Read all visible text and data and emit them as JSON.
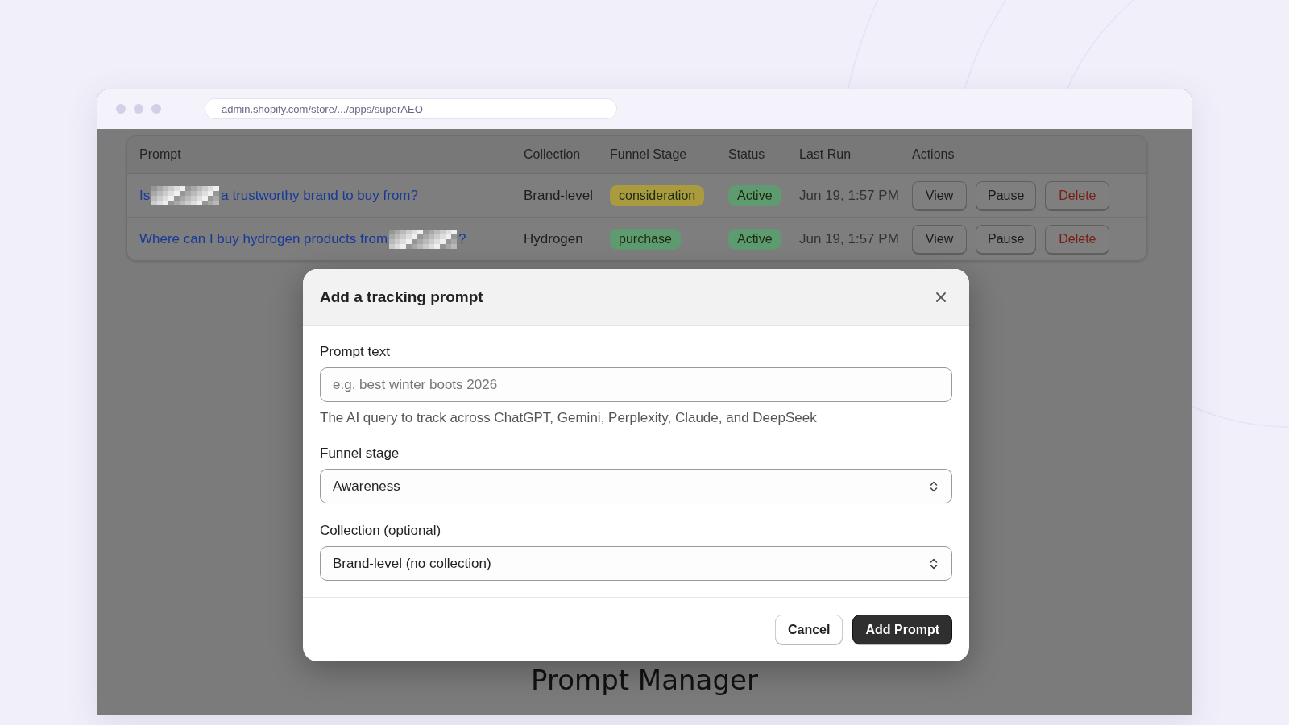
{
  "browser": {
    "url": "admin.shopify.com/store/.../apps/superAEO"
  },
  "table": {
    "columns": [
      "Prompt",
      "Collection",
      "Funnel Stage",
      "Status",
      "Last Run",
      "Actions"
    ],
    "rows": [
      {
        "prompt": {
          "before": "Is",
          "after": " a trustworthy brand to buy from?"
        },
        "collection": "Brand-level",
        "stage": {
          "label": "consideration",
          "color": "#a99b3e"
        },
        "status": {
          "label": "Active",
          "color": "#5f9b70"
        },
        "last_run": "Jun 19, 1:57 PM",
        "actions": [
          {
            "label": "View",
            "kind": "default"
          },
          {
            "label": "Pause",
            "kind": "default"
          },
          {
            "label": "Delete",
            "kind": "danger"
          }
        ]
      },
      {
        "prompt": {
          "before": "Where can I buy hydrogen products from",
          "after": "?"
        },
        "collection": "Hydrogen",
        "stage": {
          "label": "purchase",
          "color": "#5f9b70"
        },
        "status": {
          "label": "Active",
          "color": "#5f9b70"
        },
        "last_run": "Jun 19, 1:57 PM",
        "actions": [
          {
            "label": "View",
            "kind": "default"
          },
          {
            "label": "Pause",
            "kind": "default"
          },
          {
            "label": "Delete",
            "kind": "danger"
          }
        ]
      }
    ]
  },
  "modal": {
    "title": "Add a tracking prompt",
    "fields": [
      {
        "kind": "text",
        "label": "Prompt text",
        "placeholder": "e.g. best winter boots 2026",
        "help": "The AI query to track across ChatGPT, Gemini, Perplexity, Claude, and DeepSeek"
      },
      {
        "kind": "select",
        "label": "Funnel stage",
        "value": "Awareness"
      },
      {
        "kind": "select",
        "label": "Collection (optional)",
        "value": "Brand-level (no collection)"
      }
    ],
    "buttons": [
      {
        "label": "Cancel",
        "kind": "secondary"
      },
      {
        "label": "Add Prompt",
        "kind": "primary"
      }
    ]
  },
  "caption": "Prompt Manager"
}
